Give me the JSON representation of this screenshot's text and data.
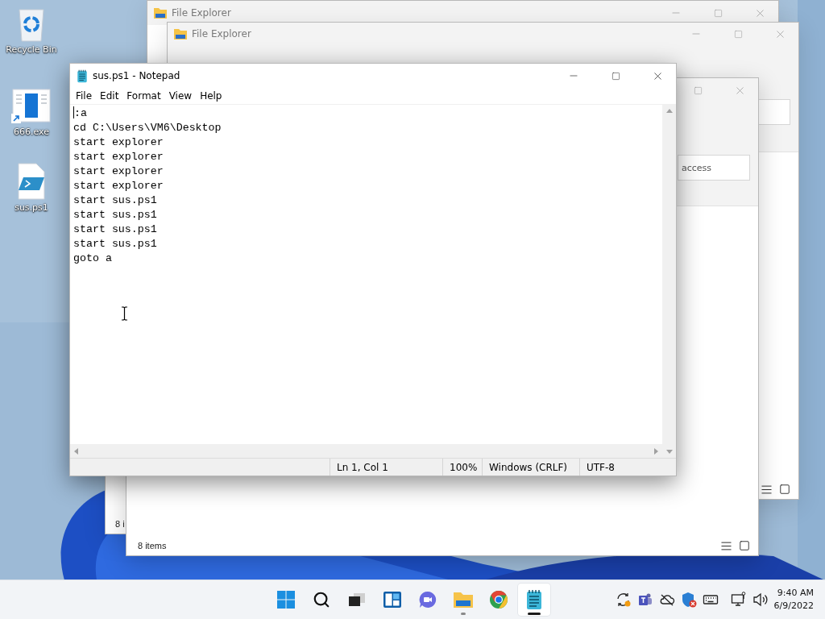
{
  "desktop_icons": [
    {
      "label": "Recycle Bin",
      "kind": "recycle"
    },
    {
      "label": "666.exe",
      "kind": "shortcut"
    },
    {
      "label": "sus.ps1",
      "kind": "script"
    }
  ],
  "explorer_back": {
    "title": "File Explorer"
  },
  "explorer_middle": {
    "title": "File Explorer"
  },
  "explorer_lower": {
    "status": "8 i"
  },
  "explorer_front": {
    "field": "access",
    "status": "8 items"
  },
  "notepad": {
    "title": "sus.ps1 - Notepad",
    "menu": [
      "File",
      "Edit",
      "Format",
      "View",
      "Help"
    ],
    "lines": [
      ":a",
      "cd C:\\Users\\VM6\\Desktop",
      "start explorer",
      "start explorer",
      "start explorer",
      "start explorer",
      "start sus.ps1",
      "start sus.ps1",
      "start sus.ps1",
      "start sus.ps1",
      "goto a"
    ],
    "status": {
      "position": "Ln 1, Col 1",
      "zoom": "100%",
      "line_ending": "Windows (CRLF)",
      "encoding": "UTF-8"
    }
  },
  "taskbar": {
    "apps": [
      {
        "kind": "start",
        "running": false,
        "selected": false
      },
      {
        "kind": "search",
        "running": false,
        "selected": false
      },
      {
        "kind": "taskview",
        "running": false,
        "selected": false
      },
      {
        "kind": "widgets",
        "running": false,
        "selected": false
      },
      {
        "kind": "chat",
        "running": false,
        "selected": false
      },
      {
        "kind": "explorer",
        "running": true,
        "selected": false
      },
      {
        "kind": "chrome",
        "running": false,
        "selected": false
      },
      {
        "kind": "notepad",
        "running": true,
        "selected": true
      }
    ],
    "tray": [
      {
        "kind": "sync"
      },
      {
        "kind": "teams"
      },
      {
        "kind": "cloud"
      },
      {
        "kind": "shield"
      },
      {
        "kind": "keyboard"
      },
      {
        "kind": "network"
      },
      {
        "kind": "volume"
      }
    ],
    "time": "9:40 AM",
    "date": "6/9/2022"
  }
}
